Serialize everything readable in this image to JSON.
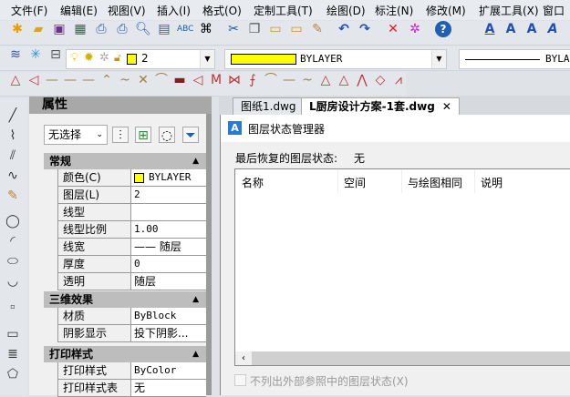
{
  "menu": [
    "文件(F)",
    "编辑(E)",
    "视图(V)",
    "插入(I)",
    "格式(O)",
    "定制工具(T)",
    "绘图(D)",
    "标注(N)",
    "修改(M)",
    "扩展工具(X)",
    "窗口"
  ],
  "toolbar1": {
    "icons": [
      "new-icon",
      "open-icon",
      "save-icon",
      "acis-icon",
      "plot-icon",
      "print-icon",
      "preview-icon",
      "publish-icon",
      "spellcheck-icon",
      "find-icon",
      "cut-icon",
      "copy-icon",
      "paste-icon",
      "paste-special-icon",
      "match-properties-icon",
      "undo-icon",
      "redo-icon",
      "delete-icon",
      "purge-icon",
      "help-icon",
      "text-icon",
      "text-style-icon",
      "text-edit-icon"
    ]
  },
  "toolbar2": {
    "layer_value": "2",
    "color_value": "BYLAYER",
    "linetype_value": "BYLAYER",
    "colors": {
      "layer_color": "#ffff00"
    }
  },
  "properties": {
    "title": "属性",
    "selection": "无选择",
    "sections": [
      {
        "title": "常规",
        "rows": [
          [
            "颜色(C)",
            "BYLAYER"
          ],
          [
            "图层(L)",
            "2"
          ],
          [
            "线型",
            ""
          ],
          [
            "线型比例",
            "1.00"
          ],
          [
            "线宽",
            "—— 随层"
          ],
          [
            "厚度",
            "0"
          ],
          [
            "透明",
            "随层"
          ]
        ]
      },
      {
        "title": "三维效果",
        "rows": [
          [
            "材质",
            "ByBlock"
          ],
          [
            "阴影显示",
            "投下阴影..."
          ]
        ]
      },
      {
        "title": "打印样式",
        "rows": [
          [
            "打印样式",
            "ByColor"
          ],
          [
            "打印样式表",
            "无"
          ]
        ]
      }
    ]
  },
  "tabs": [
    {
      "label": "图纸1.dwg",
      "active": false
    },
    {
      "label": "L厨房设计方案-1套.dwg",
      "active": true
    }
  ],
  "dialog": {
    "title": "图层状态管理器",
    "last_restored_label": "最后恢复的图层状态:",
    "last_restored_value": "无",
    "columns": [
      "名称",
      "空间",
      "与绘图相同",
      "说明"
    ],
    "checkbox_label": "不列出外部参照中的图层状态(X)"
  }
}
